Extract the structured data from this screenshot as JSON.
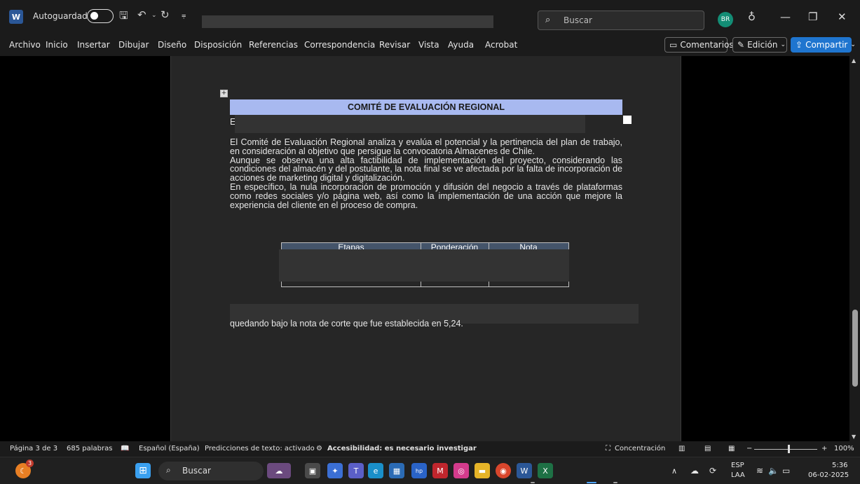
{
  "titlebar": {
    "app_icon": "W",
    "autosave_label": "Autoguardado",
    "search_placeholder": "Buscar",
    "avatar_initials": "BR"
  },
  "menu": {
    "items": [
      "Archivo",
      "Inicio",
      "Insertar",
      "Dibujar",
      "Diseño",
      "Disposición",
      "Referencias",
      "Correspondencia",
      "Revisar",
      "Vista",
      "Ayuda",
      "Acrobat"
    ],
    "comments_label": "Comentarios",
    "edit_label": "Edición",
    "share_label": "Compartir"
  },
  "document": {
    "committee_title": "COMITÉ DE EVALUACIÓN REGIONAL",
    "row_initial": "E",
    "paragraphs": [
      "El Comité de Evaluación Regional analiza y evalúa el potencial y la pertinencia del plan de trabajo, en consideración al objetivo que persigue la convocatoria Almacenes de Chile.",
      "Aunque se observa una alta factibilidad de implementación del proyecto, considerando las condiciones del almacén y del postulante, la nota final se ve afectada por la falta de incorporación de acciones de marketing digital y digitalización.",
      "En específico, la nula incorporación de promoción y difusión del negocio a través de plataformas como redes sociales y/o página web, así como la implementación de una acción que mejore la experiencia del cliente en el proceso de compra."
    ],
    "table_headers": [
      "Etapas",
      "Ponderación",
      "Nota"
    ],
    "closing_text": "quedando bajo la nota de corte que fue establecida en 5,24."
  },
  "statusbar": {
    "page": "Página 3 de 3",
    "words": "685 palabras",
    "language": "Español (España)",
    "predictions": "Predicciones de texto: activado",
    "accessibility": "Accesibilidad: es necesario investigar",
    "focus": "Concentración",
    "zoom": "100%"
  },
  "taskbar": {
    "search_label": "Buscar",
    "notification_count": "3",
    "lang_top": "ESP",
    "lang_bottom": "LAA",
    "time": "5:36",
    "date": "06-02-2025"
  },
  "colors": {
    "header_blue": "#a8b9f0",
    "table_head": "#44546a",
    "share_blue": "#1f75cf"
  }
}
